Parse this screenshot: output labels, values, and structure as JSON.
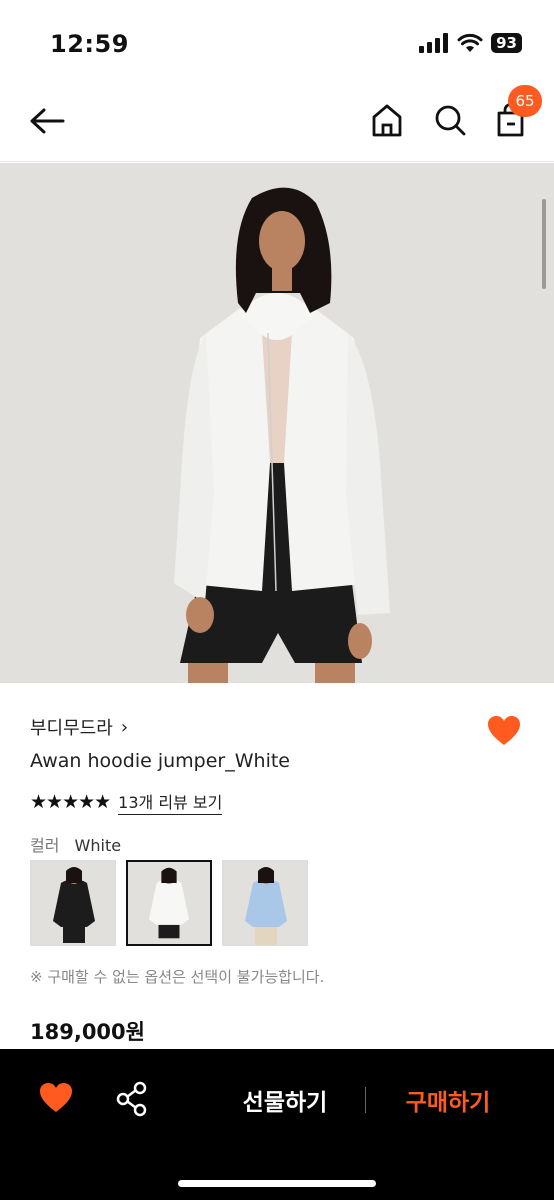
{
  "status_bar": {
    "time": "12:59",
    "battery": "93"
  },
  "header": {
    "cart_count": "65"
  },
  "product": {
    "brand": "부디무드라",
    "brand_chevron": "›",
    "name": "Awan hoodie jumper_White",
    "stars": "★★★★★",
    "review_link": "13개 리뷰 보기",
    "color_label": "컬러",
    "color_value": "White",
    "color_options": [
      "Black",
      "White",
      "Sky blue"
    ],
    "selected_color_index": 1,
    "notice": "※ 구매할 수 없는 옵션은 선택이 불가능합니다.",
    "price": "189,000원",
    "rating": 5
  },
  "bottom_bar": {
    "gift_label": "선물하기",
    "buy_label": "구매하기"
  },
  "colors": {
    "accent": "#ff5a1f",
    "bar": "#000000"
  }
}
